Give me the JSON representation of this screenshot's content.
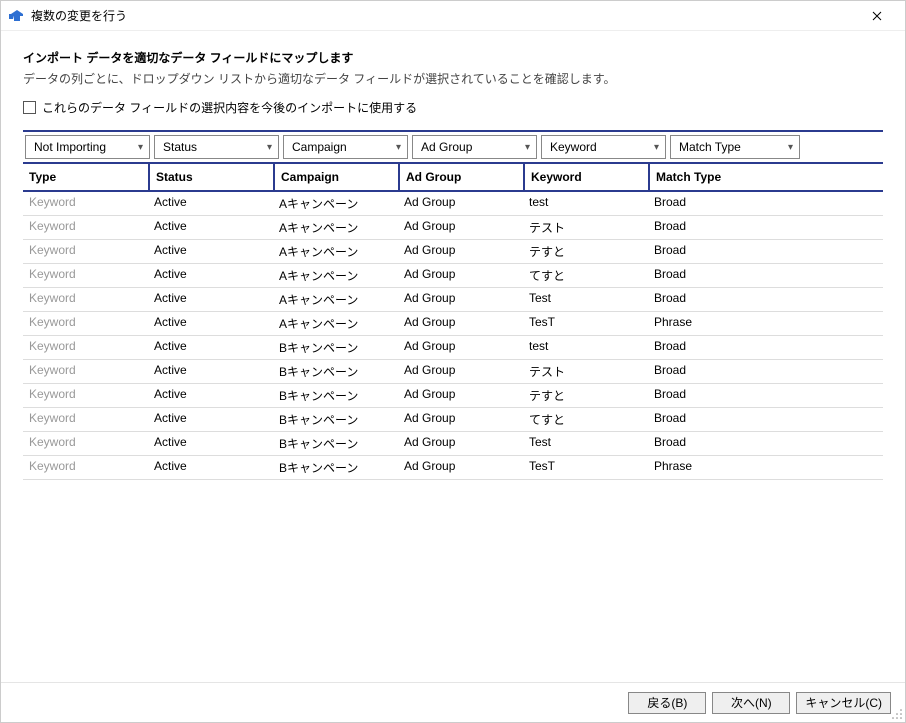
{
  "titlebar": {
    "title": "複数の変更を行う"
  },
  "heading": "インポート データを適切なデータ フィールドにマップします",
  "subheading": "データの列ごとに、ドロップダウン リストから適切なデータ フィールドが選択されていることを確認します。",
  "checkbox_label": "これらのデータ フィールドの選択内容を今後のインポートに使用する",
  "dropdowns": [
    {
      "label": "Not Importing"
    },
    {
      "label": "Status"
    },
    {
      "label": "Campaign"
    },
    {
      "label": "Ad Group"
    },
    {
      "label": "Keyword"
    },
    {
      "label": "Match Type"
    }
  ],
  "headers": {
    "type": "Type",
    "status": "Status",
    "campaign": "Campaign",
    "adgroup": "Ad Group",
    "keyword": "Keyword",
    "matchtype": "Match Type"
  },
  "rows": [
    {
      "type": "Keyword",
      "status": "Active",
      "campaign": "Aキャンペーン",
      "adgroup": "Ad Group",
      "keyword": "test",
      "matchtype": "Broad"
    },
    {
      "type": "Keyword",
      "status": "Active",
      "campaign": "Aキャンペーン",
      "adgroup": "Ad Group",
      "keyword": "テスト",
      "matchtype": "Broad"
    },
    {
      "type": "Keyword",
      "status": "Active",
      "campaign": "Aキャンペーン",
      "adgroup": "Ad Group",
      "keyword": "テすと",
      "matchtype": "Broad"
    },
    {
      "type": "Keyword",
      "status": "Active",
      "campaign": "Aキャンペーン",
      "adgroup": "Ad Group",
      "keyword": "てすと",
      "matchtype": "Broad"
    },
    {
      "type": "Keyword",
      "status": "Active",
      "campaign": "Aキャンペーン",
      "adgroup": "Ad Group",
      "keyword": "Test",
      "matchtype": "Broad"
    },
    {
      "type": "Keyword",
      "status": "Active",
      "campaign": "Aキャンペーン",
      "adgroup": "Ad Group",
      "keyword": "TesT",
      "matchtype": "Phrase"
    },
    {
      "type": "Keyword",
      "status": "Active",
      "campaign": "Bキャンペーン",
      "adgroup": "Ad Group",
      "keyword": "test",
      "matchtype": "Broad"
    },
    {
      "type": "Keyword",
      "status": "Active",
      "campaign": "Bキャンペーン",
      "adgroup": "Ad Group",
      "keyword": "テスト",
      "matchtype": "Broad"
    },
    {
      "type": "Keyword",
      "status": "Active",
      "campaign": "Bキャンペーン",
      "adgroup": "Ad Group",
      "keyword": "テすと",
      "matchtype": "Broad"
    },
    {
      "type": "Keyword",
      "status": "Active",
      "campaign": "Bキャンペーン",
      "adgroup": "Ad Group",
      "keyword": "てすと",
      "matchtype": "Broad"
    },
    {
      "type": "Keyword",
      "status": "Active",
      "campaign": "Bキャンペーン",
      "adgroup": "Ad Group",
      "keyword": "Test",
      "matchtype": "Broad"
    },
    {
      "type": "Keyword",
      "status": "Active",
      "campaign": "Bキャンペーン",
      "adgroup": "Ad Group",
      "keyword": "TesT",
      "matchtype": "Phrase"
    }
  ],
  "footer": {
    "back": "戻る(B)",
    "next": "次へ(N)",
    "cancel": "キャンセル(C)"
  }
}
